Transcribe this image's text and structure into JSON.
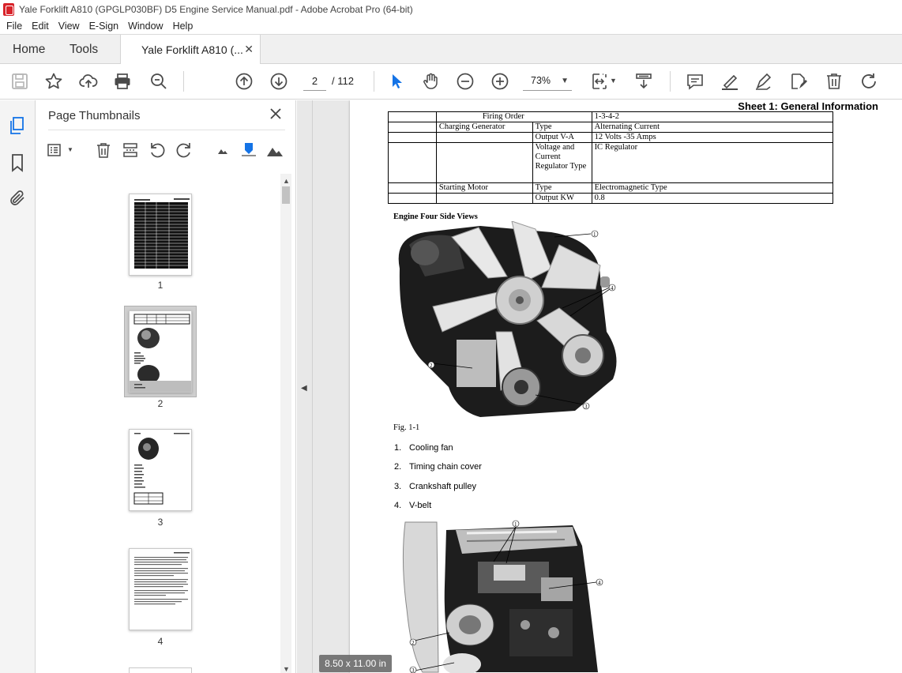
{
  "window": {
    "title": "Yale Forklift A810 (GPGLP030BF) D5 Engine Service Manual.pdf - Adobe Acrobat Pro (64-bit)"
  },
  "menu": [
    "File",
    "Edit",
    "View",
    "E-Sign",
    "Window",
    "Help"
  ],
  "tabs": {
    "home": "Home",
    "tools": "Tools",
    "document": "Yale Forklift A810 (..."
  },
  "toolbar": {
    "current_page": "2",
    "total_pages": "/ 112",
    "zoom": "73%",
    "icons": [
      "save-icon",
      "star-icon",
      "upload-icon",
      "print-icon",
      "search-icon",
      "page-up-icon",
      "page-down-icon",
      "select-arrow-icon",
      "hand-icon",
      "zoom-out-icon",
      "zoom-in-icon",
      "page-fit-icon",
      "scroll-mode-icon",
      "comment-icon",
      "highlight-icon",
      "sign-icon",
      "fill-sign-icon",
      "delete-icon",
      "rotate-icon"
    ]
  },
  "thumbnails": {
    "title": "Page Thumbnails",
    "pages": [
      "1",
      "2",
      "3",
      "4"
    ],
    "selected": "2"
  },
  "document": {
    "sheet_title": "Sheet 1: General Information",
    "spec_rows": [
      [
        "",
        "Firing Order",
        "",
        "1-3-4-2"
      ],
      [
        "",
        "Charging Generator",
        "Type",
        "Alternating Current"
      ],
      [
        "",
        "",
        "Output V-A",
        "12 Volts -35 Amps"
      ],
      [
        "",
        "",
        "Voltage and Current Regulator Type",
        "IC Regulator"
      ],
      [
        "",
        "Starting Motor",
        "Type",
        "Electromagnetic Type"
      ],
      [
        "",
        "",
        "Output KW",
        "0.8"
      ]
    ],
    "section_heading": "Engine Four Side Views",
    "figure_caption": "Fig.  1-1",
    "parts": [
      {
        "num": "1.",
        "label": "Cooling fan"
      },
      {
        "num": "2.",
        "label": "Timing chain cover"
      },
      {
        "num": "3.",
        "label": "Crankshaft pulley"
      },
      {
        "num": "4.",
        "label": "V-belt"
      }
    ],
    "callouts1": [
      "1",
      "2",
      "3",
      "4"
    ],
    "callouts2": [
      "1",
      "2",
      "4",
      "3"
    ],
    "page_size": "8.50 x 11.00 in"
  }
}
